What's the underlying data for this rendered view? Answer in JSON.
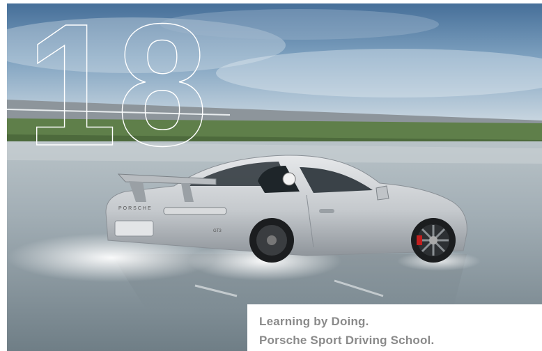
{
  "chapter_number": "18",
  "caption": {
    "line1": "Learning by Doing.",
    "line2": "Porsche Sport Driving School."
  },
  "car": {
    "rear_badge": "PORSCHE",
    "model_badge": "GT3"
  },
  "colors": {
    "sky_top": "#4f7fa8",
    "sky_bottom": "#c9d6df",
    "grass": "#5f7f4a",
    "track_wet": "#9aa7ae",
    "car_silver": "#c8ccd0",
    "caption_text": "#8a8a8a",
    "outline_number": "#ffffff"
  }
}
